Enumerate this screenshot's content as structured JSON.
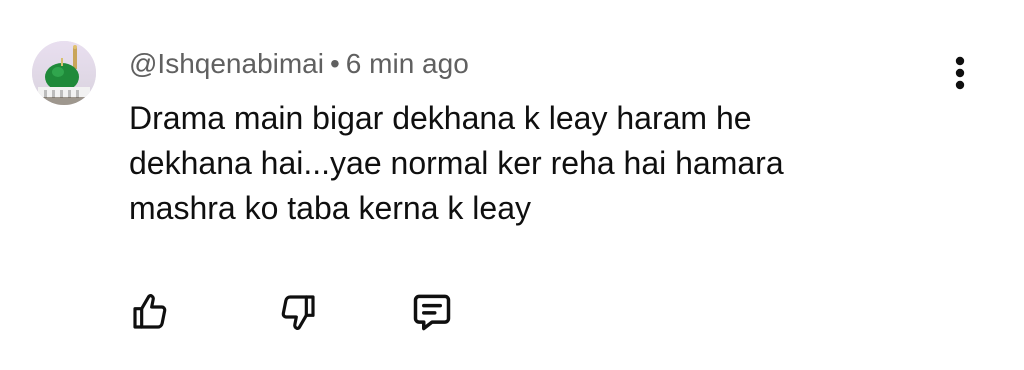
{
  "comment": {
    "author": "@Ishqenabimai",
    "separator": "•",
    "timestamp": "6 min ago",
    "text_lines": [
      "Drama main bigar dekhana k leay haram he",
      "dekhana hai...yae normal ker reha hai hamara",
      "mashra ko taba kerna k leay"
    ],
    "avatar_icon": "green-dome-icon",
    "actions": {
      "like_icon": "thumbs-up-icon",
      "dislike_icon": "thumbs-down-icon",
      "reply_icon": "comment-reply-icon",
      "more_icon": "more-vertical-icon"
    }
  },
  "colors": {
    "text_primary": "#0f0f0f",
    "text_secondary": "#606060",
    "background": "#ffffff"
  }
}
